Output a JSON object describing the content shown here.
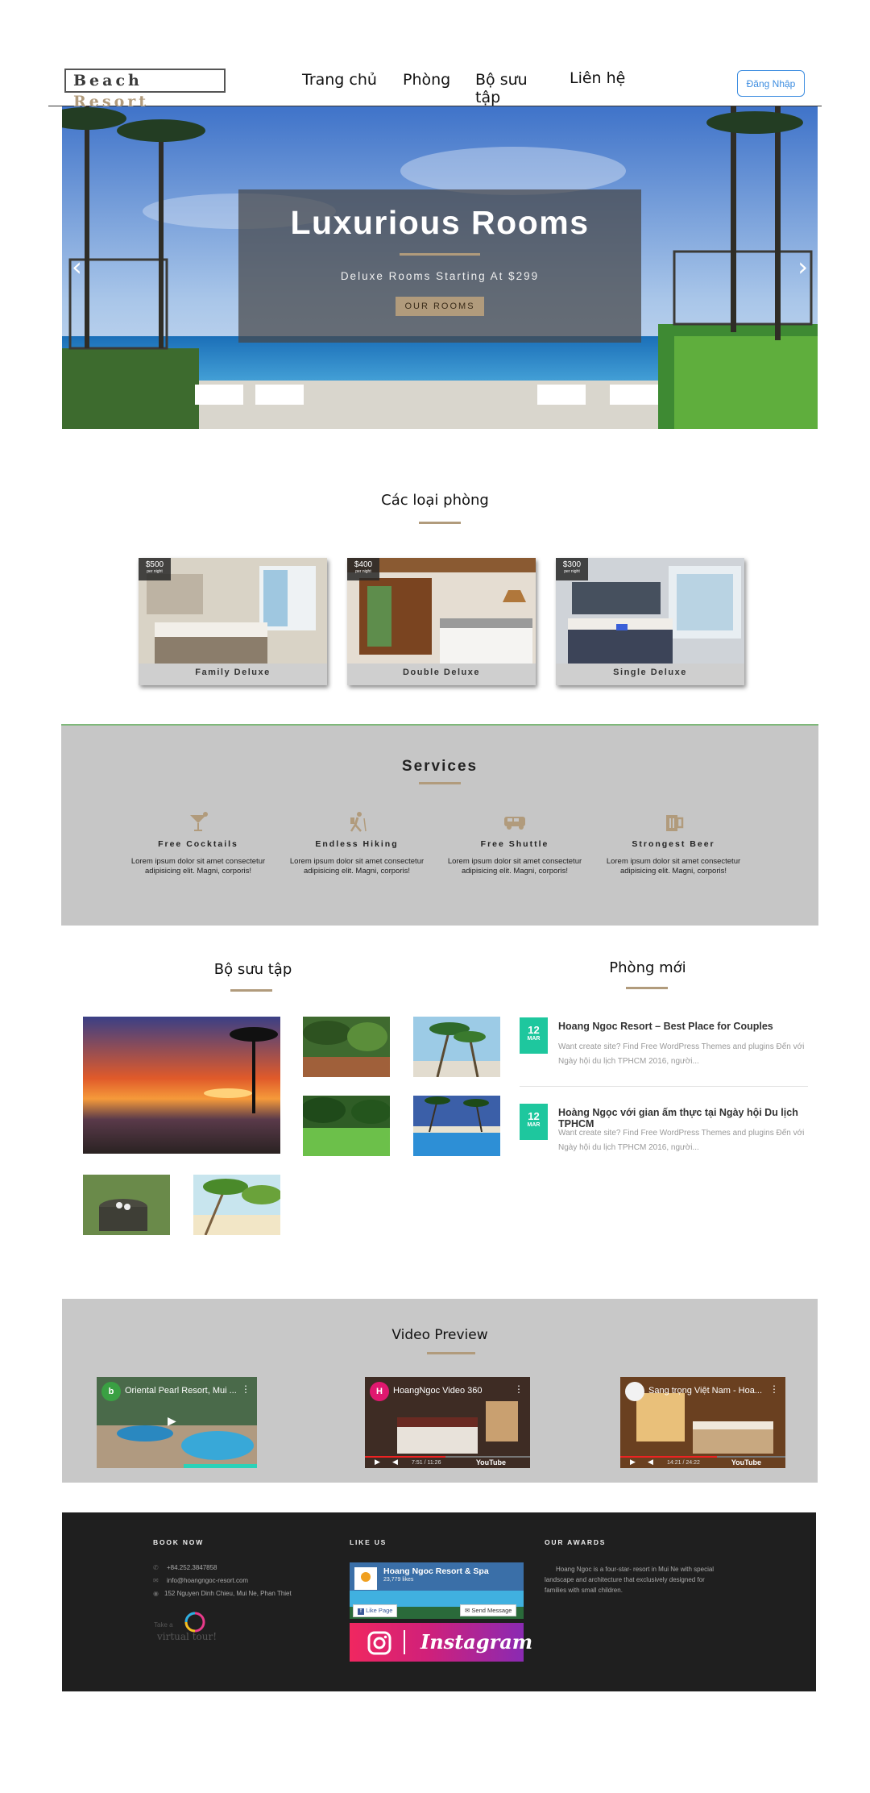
{
  "header": {
    "logo_word1": "Beach",
    "logo_word2": "Resort",
    "nav": [
      "Trang chủ",
      "Phòng",
      "Bộ sưu tập",
      "Liên hệ"
    ],
    "login_label": "Đăng Nhập"
  },
  "hero": {
    "title": "Luxurious Rooms",
    "subtitle": "Deluxe Rooms Starting At $299",
    "button_label": "OUR ROOMS",
    "arrow_left": "‹",
    "arrow_right": "›"
  },
  "rooms_section": {
    "title": "Các loại phòng",
    "rooms": [
      {
        "price": "$500",
        "unit": "per night",
        "name": "Family Deluxe"
      },
      {
        "price": "$400",
        "unit": "per night",
        "name": "Double Deluxe"
      },
      {
        "price": "$300",
        "unit": "per night",
        "name": "Single Deluxe"
      }
    ]
  },
  "services": {
    "title": "Services",
    "items": [
      {
        "icon": "cocktail-icon",
        "name": "Free Cocktails",
        "text": "Lorem ipsum dolor sit amet consectetur adipisicing elit. Magni, corporis!"
      },
      {
        "icon": "hiking-icon",
        "name": "Endless Hiking",
        "text": "Lorem ipsum dolor sit amet consectetur adipisicing elit. Magni, corporis!"
      },
      {
        "icon": "shuttle-icon",
        "name": "Free Shuttle",
        "text": "Lorem ipsum dolor sit amet consectetur adipisicing elit. Magni, corporis!"
      },
      {
        "icon": "beer-icon",
        "name": "Strongest Beer",
        "text": "Lorem ipsum dolor sit amet consectetur adipisicing elit. Magni, corporis!"
      }
    ]
  },
  "collection": {
    "title": "Bộ sưu tập"
  },
  "news": {
    "title": "Phòng mới",
    "items": [
      {
        "day": "12",
        "month": "MAR",
        "title": "Hoang Ngoc Resort – Best Place for Couples",
        "desc": "Want create site? Find Free WordPress Themes and plugins Đến với Ngày hội du lịch TPHCM 2016, người..."
      },
      {
        "day": "12",
        "month": "MAR",
        "title": "Hoàng Ngọc với gian ấm thực tại Ngày hội Du lịch TPHCM",
        "desc": "Want create site? Find Free WordPress Themes and plugins Đến với Ngày hội du lịch TPHCM 2016, người..."
      }
    ]
  },
  "videos": {
    "title": "Video Preview",
    "items": [
      {
        "avatar": "b",
        "title": "Oriental Pearl Resort, Mui ...",
        "time": "",
        "brand": ""
      },
      {
        "avatar": "H",
        "title": "HoangNgoc Video 360",
        "time": "7:51 / 11:26",
        "brand": "YouTube"
      },
      {
        "avatar": "",
        "title": "Sang trọng Việt Nam - Hoa...",
        "time": "14:21 / 24:22",
        "brand": "YouTube"
      }
    ]
  },
  "footer": {
    "book_now": {
      "heading": "BOOK NOW",
      "phone": "+84.252.3847858",
      "email": "info@hoangngoc-resort.com",
      "address": "152 Nguyen Dinh Chieu, Mui Ne, Phan Thiet",
      "tour_label": "Take a",
      "tour_brand": "virtual tour!"
    },
    "like_us": {
      "heading": "LIKE US",
      "fb_name": "Hoang Ngoc Resort & Spa",
      "fb_likes": "23,779 likes",
      "fb_like_btn": "Like Page",
      "fb_msg_btn": "Send Message",
      "instagram": "Instagram"
    },
    "awards": {
      "heading": "OUR AWARDS",
      "text": "Hoang Ngoc is a four-star- resort in Mui Ne with special landscape and architecture that exclusively designed for families with small children."
    }
  },
  "colors": {
    "accent": "#b19b7c",
    "login": "#3d8de0",
    "date_badge": "#1ec79e",
    "footer_bg": "#1f1f1f",
    "section_gray": "#c6c6c6"
  }
}
